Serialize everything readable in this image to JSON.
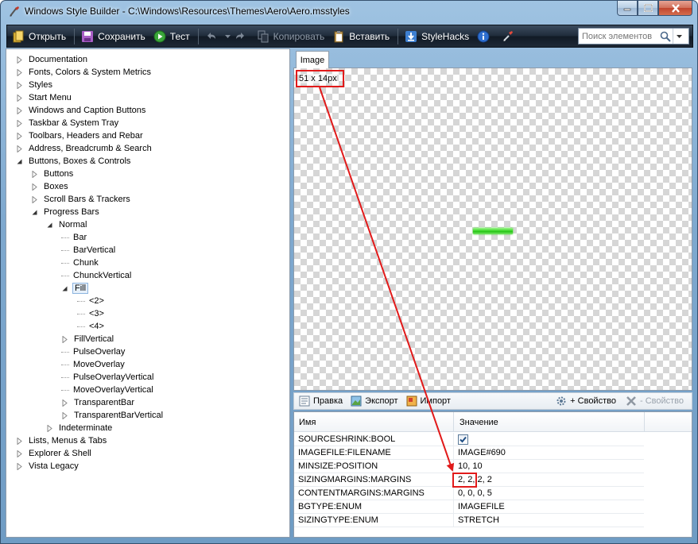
{
  "window": {
    "title": "Windows Style Builder - C:\\Windows\\Resources\\Themes\\Aero\\Aero.msstyles"
  },
  "toolbar": {
    "open_label": "Открыть",
    "save_label": "Сохранить",
    "test_label": "Тест",
    "copy_label": "Копировать",
    "paste_label": "Вставить",
    "stylehacks_label": "StyleHacks",
    "search_placeholder": "Поиск элементов"
  },
  "tree": {
    "items": [
      {
        "label": "Documentation"
      },
      {
        "label": "Fonts, Colors & System Metrics"
      },
      {
        "label": "Styles"
      },
      {
        "label": "Start Menu"
      },
      {
        "label": "Windows and Caption Buttons"
      },
      {
        "label": "Taskbar & System Tray"
      },
      {
        "label": "Toolbars, Headers and Rebar"
      },
      {
        "label": "Address, Breadcrumb & Search"
      },
      {
        "label": "Buttons, Boxes & Controls"
      },
      {
        "label": "Buttons"
      },
      {
        "label": "Boxes"
      },
      {
        "label": "Scroll Bars & Trackers"
      },
      {
        "label": "Progress Bars"
      },
      {
        "label": "Normal"
      },
      {
        "label": "Bar"
      },
      {
        "label": "BarVertical"
      },
      {
        "label": "Chunk"
      },
      {
        "label": "ChunckVertical"
      },
      {
        "label": "Fill"
      },
      {
        "label": "<2>"
      },
      {
        "label": "<3>"
      },
      {
        "label": "<4>"
      },
      {
        "label": "FillVertical"
      },
      {
        "label": "PulseOverlay"
      },
      {
        "label": "MoveOverlay"
      },
      {
        "label": "PulseOverlayVertical"
      },
      {
        "label": "MoveOverlayVertical"
      },
      {
        "label": "TransparentBar"
      },
      {
        "label": "TransparentBarVertical"
      },
      {
        "label": "Indeterminate"
      },
      {
        "label": "Lists, Menus & Tabs"
      },
      {
        "label": "Explorer & Shell"
      },
      {
        "label": "Vista Legacy"
      }
    ]
  },
  "image_panel": {
    "tab_label": "Image",
    "size_text": "51 x 14px"
  },
  "props_toolbar": {
    "edit_label": "Правка",
    "export_label": "Экспорт",
    "import_label": "Импорт",
    "add_property_label": "+ Свойство",
    "remove_property_label": "- Свойство"
  },
  "props_grid": {
    "col_name": "Имя",
    "col_value": "Значение",
    "rows": [
      {
        "name": "SOURCESHRINK:BOOL",
        "value": "",
        "checked": true
      },
      {
        "name": "IMAGEFILE:FILENAME",
        "value": "IMAGE#690"
      },
      {
        "name": "MINSIZE:POSITION",
        "value": "10, 10"
      },
      {
        "name": "SIZINGMARGINS:MARGINS",
        "value": "2, 2, 2, 2"
      },
      {
        "name": "CONTENTMARGINS:MARGINS",
        "value": "0, 0, 0, 5"
      },
      {
        "name": "BGTYPE:ENUM",
        "value": "IMAGEFILE"
      },
      {
        "name": "SIZINGTYPE:ENUM",
        "value": "STRETCH"
      }
    ]
  },
  "colors": {
    "annotation_red": "#e11a1a",
    "fill_green": "#3fd72c",
    "toolbar_dark": "#1f2b3a"
  }
}
